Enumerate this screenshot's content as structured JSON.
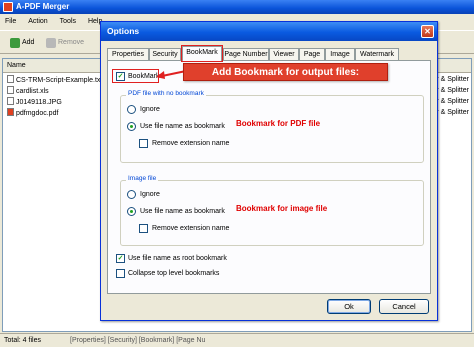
{
  "app": {
    "title": "A-PDF Merger",
    "menu": [
      "File",
      "Action",
      "Tools",
      "Help"
    ],
    "toolbar": {
      "add_label": "Add",
      "remove_label": "Remove"
    },
    "list_header": "Name",
    "files": [
      "CS-TRM-Script-Example.txt",
      "cardlist.xls",
      "J0149118.JPG",
      "pdfmgdoc.pdf"
    ],
    "right_col": [
      "r & Splitter",
      "r & Splitter",
      "r & Splitter",
      "r & Splitter"
    ],
    "status": {
      "total": "Total: 4 files",
      "tabs": "[Properties] [Security] [Bookmark] [Page Nu"
    }
  },
  "dialog": {
    "title": "Options",
    "close": "✕",
    "tabs": [
      "Properties",
      "Security",
      "BookMark",
      "Page Number",
      "Viewer",
      "Page",
      "Image",
      "Watermark"
    ],
    "active_tab": "BookMark",
    "bookmark_checkbox": "BookMark",
    "callout": "Add Bookmark for output files:",
    "pdf_group": {
      "title": "PDF file with no bookmark",
      "ignore": "Ignore",
      "use_name": "Use file name as bookmark",
      "remove_ext": "Remove extension name",
      "note": "Bookmark for PDF file"
    },
    "image_group": {
      "title": "Image file",
      "ignore": "Ignore",
      "use_name": "Use file name as bookmark",
      "remove_ext": "Remove extension name",
      "note": "Bookmark for image file"
    },
    "root_bookmark": "Use file name as root bookmark",
    "collapse": "Collapse top level bookmarks",
    "ok": "Ok",
    "cancel": "Cancel"
  },
  "colors": {
    "accent": "#0a53d9",
    "callout": "#e0402c",
    "note": "#e00000"
  }
}
